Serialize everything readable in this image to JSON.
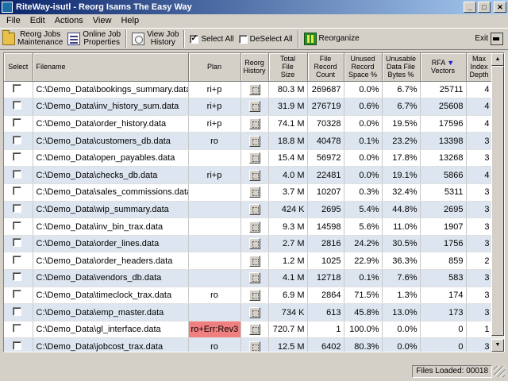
{
  "window": {
    "title": "RiteWay-isutl - Reorg Isams The Easy Way"
  },
  "menu": [
    "File",
    "Edit",
    "Actions",
    "View",
    "Help"
  ],
  "toolbar": {
    "reorg_jobs": [
      "Reorg Jobs",
      "Maintenance"
    ],
    "online_job": [
      "Online Job",
      "Properties"
    ],
    "view_job": [
      "View Job",
      "History"
    ],
    "select_all": "Select All",
    "deselect_all": "DeSelect All",
    "reorganize": "Reorganize",
    "exit": "Exit"
  },
  "columns": {
    "select": "Select",
    "filename": "Filename",
    "plan": "Plan",
    "reorg_history": [
      "Reorg",
      "History"
    ],
    "total_file_size": [
      "Total",
      "File",
      "Size"
    ],
    "file_record_count": [
      "File",
      "Record",
      "Count"
    ],
    "unused_record_space": [
      "Unused",
      "Record",
      "Space %"
    ],
    "unusable_data_file_bytes": [
      "Unusable",
      "Data File",
      "Bytes %"
    ],
    "rfa_vectors": [
      "RFA",
      "Vectors"
    ],
    "max_index_depth": [
      "Max",
      "Index",
      "Depth"
    ]
  },
  "rows": [
    {
      "filename": "C:\\Demo_Data\\bookings_summary.data",
      "plan": "ri+p",
      "size": "80.3 M",
      "count": "269687",
      "unused": "0.0%",
      "unusable": "6.7%",
      "rfa": "25711",
      "depth": "4"
    },
    {
      "filename": "C:\\Demo_Data\\inv_history_sum.data",
      "plan": "ri+p",
      "size": "31.9 M",
      "count": "276719",
      "unused": "0.6%",
      "unusable": "6.7%",
      "rfa": "25608",
      "depth": "4"
    },
    {
      "filename": "C:\\Demo_Data\\order_history.data",
      "plan": "ri+p",
      "size": "74.1 M",
      "count": "70328",
      "unused": "0.0%",
      "unusable": "19.5%",
      "rfa": "17596",
      "depth": "4"
    },
    {
      "filename": "C:\\Demo_Data\\customers_db.data",
      "plan": "ro",
      "size": "18.8 M",
      "count": "40478",
      "unused": "0.1%",
      "unusable": "23.2%",
      "rfa": "13398",
      "depth": "3"
    },
    {
      "filename": "C:\\Demo_Data\\open_payables.data",
      "plan": "",
      "size": "15.4 M",
      "count": "56972",
      "unused": "0.0%",
      "unusable": "17.8%",
      "rfa": "13268",
      "depth": "3"
    },
    {
      "filename": "C:\\Demo_Data\\checks_db.data",
      "plan": "ri+p",
      "size": "4.0 M",
      "count": "22481",
      "unused": "0.0%",
      "unusable": "19.1%",
      "rfa": "5866",
      "depth": "4"
    },
    {
      "filename": "C:\\Demo_Data\\sales_commissions.data",
      "plan": "",
      "size": "3.7 M",
      "count": "10207",
      "unused": "0.3%",
      "unusable": "32.4%",
      "rfa": "5311",
      "depth": "3"
    },
    {
      "filename": "C:\\Demo_Data\\wip_summary.data",
      "plan": "",
      "size": "424 K",
      "count": "2695",
      "unused": "5.4%",
      "unusable": "44.8%",
      "rfa": "2695",
      "depth": "3"
    },
    {
      "filename": "C:\\Demo_Data\\inv_bin_trax.data",
      "plan": "",
      "size": "9.3 M",
      "count": "14598",
      "unused": "5.6%",
      "unusable": "11.0%",
      "rfa": "1907",
      "depth": "3"
    },
    {
      "filename": "C:\\Demo_Data\\order_lines.data",
      "plan": "",
      "size": "2.7 M",
      "count": "2816",
      "unused": "24.2%",
      "unusable": "30.5%",
      "rfa": "1756",
      "depth": "3"
    },
    {
      "filename": "C:\\Demo_Data\\order_headers.data",
      "plan": "",
      "size": "1.2 M",
      "count": "1025",
      "unused": "22.9%",
      "unusable": "36.3%",
      "rfa": "859",
      "depth": "2"
    },
    {
      "filename": "C:\\Demo_Data\\vendors_db.data",
      "plan": "",
      "size": "4.1 M",
      "count": "12718",
      "unused": "0.1%",
      "unusable": "7.6%",
      "rfa": "583",
      "depth": "3"
    },
    {
      "filename": "C:\\Demo_Data\\timeclock_trax.data",
      "plan": "ro",
      "size": "6.9 M",
      "count": "2864",
      "unused": "71.5%",
      "unusable": "1.3%",
      "rfa": "174",
      "depth": "3"
    },
    {
      "filename": "C:\\Demo_Data\\emp_master.data",
      "plan": "",
      "size": "734 K",
      "count": "613",
      "unused": "45.8%",
      "unusable": "13.0%",
      "rfa": "173",
      "depth": "3"
    },
    {
      "filename": "C:\\Demo_Data\\gl_interface.data",
      "plan": "ro+Err:Rev3",
      "plan_error": true,
      "size": "720.7 M",
      "count": "1",
      "unused": "100.0%",
      "unusable": "0.0%",
      "rfa": "0",
      "depth": "1"
    },
    {
      "filename": "C:\\Demo_Data\\jobcost_trax.data",
      "plan": "ro",
      "size": "12.5 M",
      "count": "6402",
      "unused": "80.3%",
      "unusable": "0.0%",
      "rfa": "0",
      "depth": "3"
    }
  ],
  "status": {
    "files_loaded": "Files Loaded: 00018"
  }
}
